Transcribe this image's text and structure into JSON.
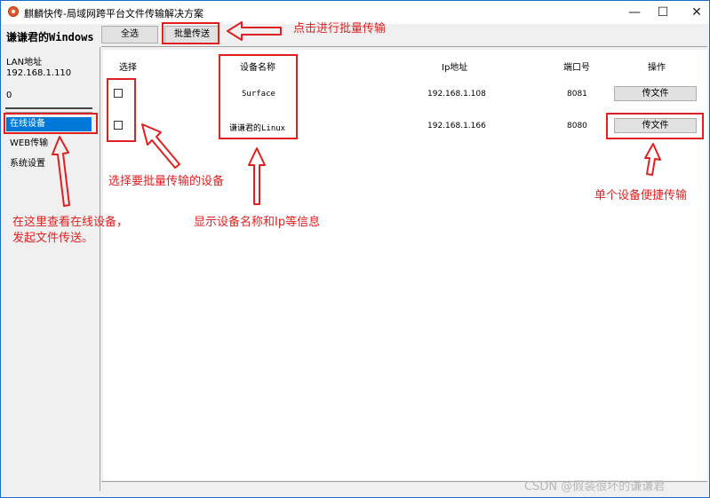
{
  "window": {
    "title": "麒麟快传-局域网跨平台文件传输解决方案",
    "minimize": "—",
    "maximize": "☐",
    "close": "✕"
  },
  "sidebar": {
    "device_title": "谦谦君的Windows",
    "lan_label": "LAN地址",
    "lan_ip": "192.168.1.110",
    "counter": "0",
    "items": [
      {
        "label": "在线设备",
        "selected": true
      },
      {
        "label": "WEB传输",
        "selected": false
      },
      {
        "label": "系统设置",
        "selected": false
      }
    ]
  },
  "toolbar": {
    "select_all": "全选",
    "batch_send": "批量传送"
  },
  "table": {
    "headers": {
      "select": "选择",
      "name": "设备名称",
      "ip": "Ip地址",
      "port": "端口号",
      "action": "操作"
    },
    "rows": [
      {
        "name": "Surface",
        "ip": "192.168.1.108",
        "port": "8081",
        "action": "传文件",
        "checked": false
      },
      {
        "name": "谦谦君的Linux",
        "ip": "192.168.1.166",
        "port": "8080",
        "action": "传文件",
        "checked": false
      }
    ]
  },
  "annotations": {
    "batch": "点击进行批量传输",
    "select_devices": "选择要批量传输的设备",
    "device_info": "显示设备名称和Ip等信息",
    "single": "单个设备便捷传输",
    "online_line1": "在这里查看在线设备，",
    "online_line2": "发起文件传送。"
  },
  "watermark": "CSDN @假装很坏的谦谦君",
  "colors": {
    "annotation": "#e02020",
    "selection": "#0078d7",
    "window_border": "#1e6bc6"
  }
}
